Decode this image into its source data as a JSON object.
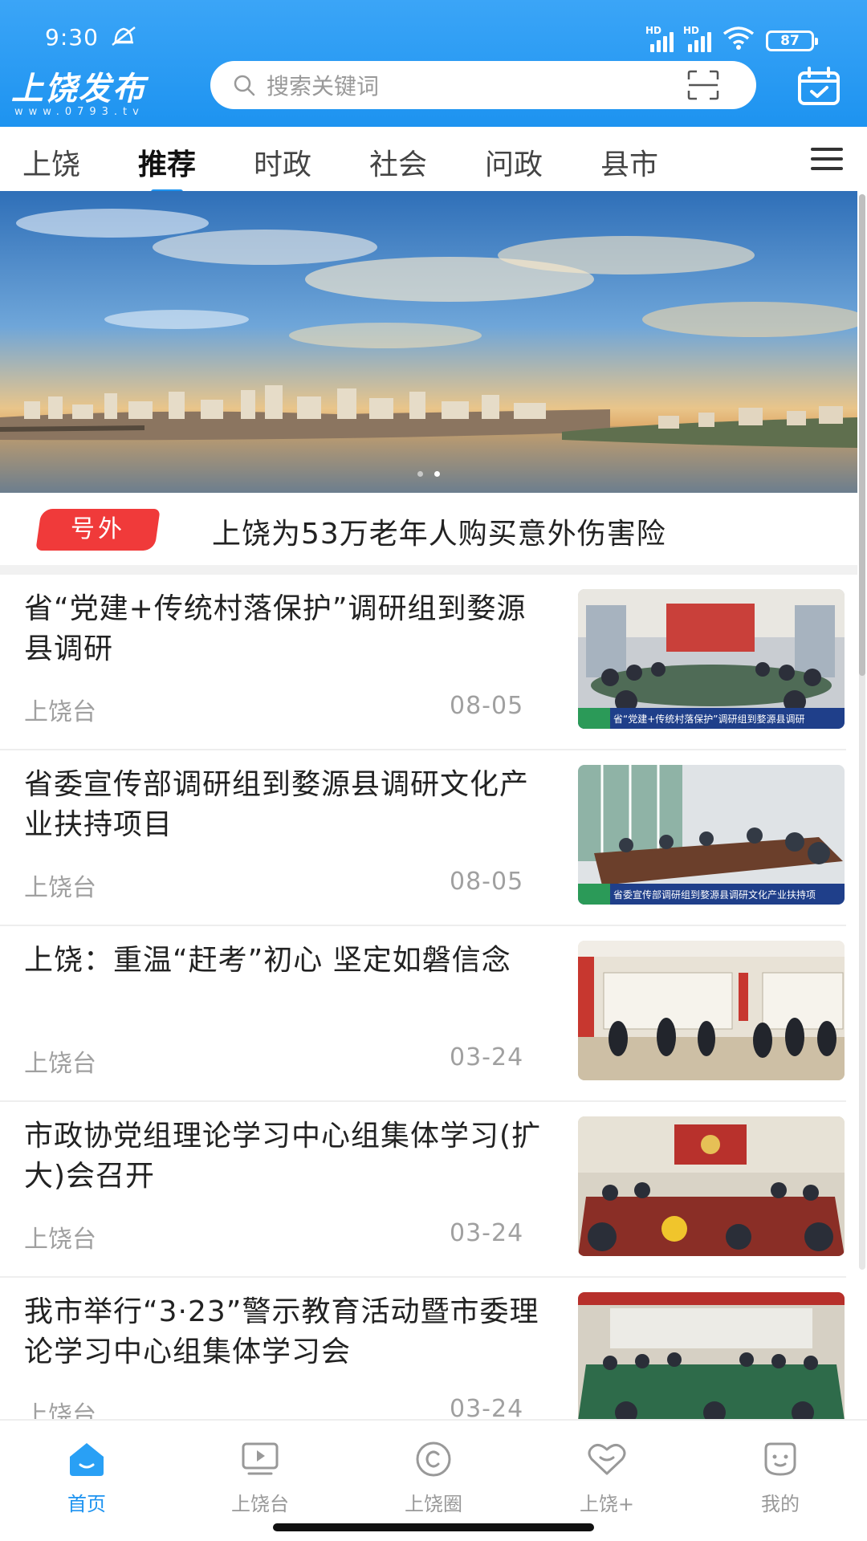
{
  "status_bar": {
    "time": "9:30",
    "battery": "87",
    "net1": "HD",
    "net2": "HD"
  },
  "header": {
    "logo_text": "上饶发布",
    "logo_sub": "www.0793.tv",
    "search_placeholder": "搜索关键词",
    "accent_color": "#1d93f0"
  },
  "tabs": [
    {
      "label": "上饶"
    },
    {
      "label": "推荐",
      "active": true
    },
    {
      "label": "时政"
    },
    {
      "label": "社会"
    },
    {
      "label": "问政"
    },
    {
      "label": "县市"
    }
  ],
  "banner": {
    "slide_count": 2,
    "active_slide": 2
  },
  "headline": {
    "badge": "号外",
    "text": "上饶为53万老年人购买意外伤害险"
  },
  "news": [
    {
      "title": "省“党建+传统村落保护”调研组到婺源县调研",
      "source": "上饶台",
      "date": "08-05",
      "thumb_caption": "省“党建+传统村落保护”调研组到婺源县调研"
    },
    {
      "title": "省委宣传部调研组到婺源县调研文化产业扶持项目",
      "source": "上饶台",
      "date": "08-05",
      "thumb_caption": "省委宣传部调研组到婺源县调研文化产业扶持项"
    },
    {
      "title": "上饶：重温“赶考”初心  坚定如磐信念",
      "source": "上饶台",
      "date": "03-24"
    },
    {
      "title": "市政协党组理论学习中心组集体学习(扩大)会召开",
      "source": "上饶台",
      "date": "03-24"
    },
    {
      "title": "我市举行“3·23”警示教育活动暨市委理论学习中心组集体学习会",
      "source": "上饶台",
      "date": "03-24"
    }
  ],
  "bottom_nav": [
    {
      "label": "首页",
      "icon": "home-icon",
      "active": true
    },
    {
      "label": "上饶台",
      "icon": "tv-play-icon"
    },
    {
      "label": "上饶圈",
      "icon": "circle-icon"
    },
    {
      "label": "上饶+",
      "icon": "heart-icon"
    },
    {
      "label": "我的",
      "icon": "profile-icon"
    }
  ]
}
